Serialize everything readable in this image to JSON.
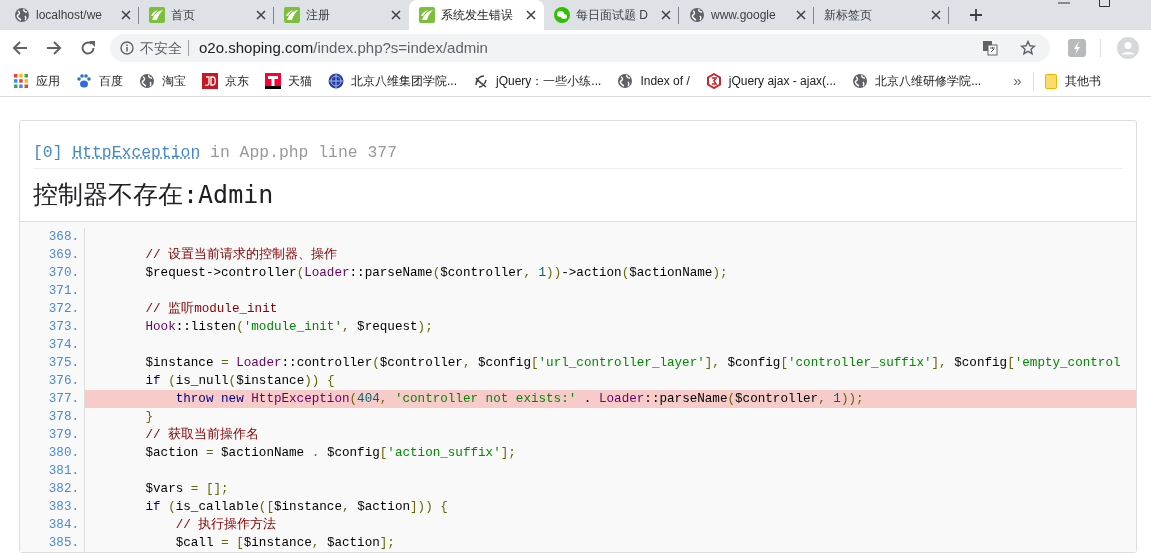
{
  "tabs": [
    {
      "title": "localhost/we",
      "kind": "globe",
      "selected": false
    },
    {
      "title": "首页",
      "kind": "leaf",
      "selected": false
    },
    {
      "title": "注册",
      "kind": "leaf",
      "selected": false
    },
    {
      "title": "系统发生错误",
      "kind": "leaf",
      "selected": true
    },
    {
      "title": "每日面试题 D",
      "kind": "chat",
      "selected": false
    },
    {
      "title": "www.google",
      "kind": "globe",
      "selected": false
    },
    {
      "title": "新标签页",
      "kind": "blank",
      "selected": false
    }
  ],
  "address": {
    "security": "不安全",
    "host": "o2o.shoping.com",
    "path": "/index.php?s=index/admin"
  },
  "bookmarks": [
    {
      "label": "应用",
      "kind": "apps"
    },
    {
      "label": "百度",
      "kind": "paw"
    },
    {
      "label": "淘宝",
      "kind": "globe"
    },
    {
      "label": "京东",
      "kind": "red"
    },
    {
      "label": "天猫",
      "kind": "tee"
    },
    {
      "label": "北京八维集团学院...",
      "kind": "orb"
    },
    {
      "label": "jQuery：一些小练...",
      "kind": "curl"
    },
    {
      "label": "Index of /",
      "kind": "globe"
    },
    {
      "label": "jQuery ajax - ajax(...",
      "kind": "hex"
    },
    {
      "label": "北京八维研修学院...",
      "kind": "globe"
    }
  ],
  "bookmarks_overflow": "»",
  "other_bookmarks": "其他书",
  "error": {
    "index": "[0]",
    "exception": "HttpException",
    "location": "in App.php line 377",
    "message": "控制器不存在:Admin"
  },
  "code": [
    {
      "number": "368.",
      "highlighted": false
    },
    {
      "number": "369.",
      "highlighted": false,
      "tokens": [
        {
          "kind": "com",
          "text": "        // 设置当前请求的控制器、操作"
        }
      ]
    },
    {
      "number": "370.",
      "highlighted": false,
      "tokens": [
        {
          "kind": "pln",
          "text": "        $request->controller"
        },
        {
          "kind": "pun",
          "text": "("
        },
        {
          "kind": "typ",
          "text": "Loader"
        },
        {
          "kind": "pln",
          "text": "::parseName"
        },
        {
          "kind": "pun",
          "text": "("
        },
        {
          "kind": "pln",
          "text": "$controller"
        },
        {
          "kind": "pun",
          "text": ", "
        },
        {
          "kind": "lit",
          "text": "1"
        },
        {
          "kind": "pun",
          "text": "))"
        },
        {
          "kind": "pln",
          "text": "->action"
        },
        {
          "kind": "pun",
          "text": "("
        },
        {
          "kind": "pln",
          "text": "$actionName"
        },
        {
          "kind": "pun",
          "text": ");"
        }
      ]
    },
    {
      "number": "371.",
      "highlighted": false
    },
    {
      "number": "372.",
      "highlighted": false,
      "tokens": [
        {
          "kind": "com",
          "text": "        // 监听module_init"
        }
      ]
    },
    {
      "number": "373.",
      "highlighted": false,
      "tokens": [
        {
          "kind": "typ",
          "text": "        Hook"
        },
        {
          "kind": "pln",
          "text": "::listen"
        },
        {
          "kind": "pun",
          "text": "("
        },
        {
          "kind": "str",
          "text": "'module_init'"
        },
        {
          "kind": "pun",
          "text": ", "
        },
        {
          "kind": "pln",
          "text": "$request"
        },
        {
          "kind": "pun",
          "text": ");"
        }
      ]
    },
    {
      "number": "374.",
      "highlighted": false
    },
    {
      "number": "375.",
      "highlighted": false,
      "tokens": [
        {
          "kind": "pln",
          "text": "        $instance "
        },
        {
          "kind": "pun",
          "text": "= "
        },
        {
          "kind": "typ",
          "text": "Loader"
        },
        {
          "kind": "pln",
          "text": "::controller"
        },
        {
          "kind": "pun",
          "text": "("
        },
        {
          "kind": "pln",
          "text": "$controller"
        },
        {
          "kind": "pun",
          "text": ", "
        },
        {
          "kind": "pln",
          "text": "$config"
        },
        {
          "kind": "pun",
          "text": "["
        },
        {
          "kind": "str",
          "text": "'url_controller_layer'"
        },
        {
          "kind": "pun",
          "text": "], "
        },
        {
          "kind": "pln",
          "text": "$config"
        },
        {
          "kind": "pun",
          "text": "["
        },
        {
          "kind": "str",
          "text": "'controller_suffix'"
        },
        {
          "kind": "pun",
          "text": "], "
        },
        {
          "kind": "pln",
          "text": "$config"
        },
        {
          "kind": "pun",
          "text": "["
        },
        {
          "kind": "str",
          "text": "'empty_control"
        }
      ]
    },
    {
      "number": "376.",
      "highlighted": false,
      "tokens": [
        {
          "kind": "kwd",
          "text": "        if"
        },
        {
          "kind": "pun",
          "text": " ("
        },
        {
          "kind": "pln",
          "text": "is_null"
        },
        {
          "kind": "pun",
          "text": "("
        },
        {
          "kind": "pln",
          "text": "$instance"
        },
        {
          "kind": "pun",
          "text": ")) {"
        }
      ]
    },
    {
      "number": "377.",
      "highlighted": true,
      "tokens": [
        {
          "kind": "kwd",
          "text": "            throw new"
        },
        {
          "kind": "typ",
          "text": " HttpException"
        },
        {
          "kind": "pun",
          "text": "("
        },
        {
          "kind": "lit",
          "text": "404"
        },
        {
          "kind": "pun",
          "text": ", "
        },
        {
          "kind": "str",
          "text": "'controller not exists:'"
        },
        {
          "kind": "pln",
          "text": " . "
        },
        {
          "kind": "typ",
          "text": "Loader"
        },
        {
          "kind": "pln",
          "text": "::parseName"
        },
        {
          "kind": "pun",
          "text": "("
        },
        {
          "kind": "pln",
          "text": "$controller"
        },
        {
          "kind": "pun",
          "text": ", "
        },
        {
          "kind": "lit",
          "text": "1"
        },
        {
          "kind": "pun",
          "text": "));"
        }
      ]
    },
    {
      "number": "378.",
      "highlighted": false,
      "tokens": [
        {
          "kind": "pun",
          "text": "        }"
        }
      ]
    },
    {
      "number": "379.",
      "highlighted": false,
      "tokens": [
        {
          "kind": "com",
          "text": "        // 获取当前操作名"
        }
      ]
    },
    {
      "number": "380.",
      "highlighted": false,
      "tokens": [
        {
          "kind": "pln",
          "text": "        $action "
        },
        {
          "kind": "pun",
          "text": "= "
        },
        {
          "kind": "pln",
          "text": "$actionName "
        },
        {
          "kind": "pun",
          "text": ". "
        },
        {
          "kind": "pln",
          "text": "$config"
        },
        {
          "kind": "pun",
          "text": "["
        },
        {
          "kind": "str",
          "text": "'action_suffix'"
        },
        {
          "kind": "pun",
          "text": "];"
        }
      ]
    },
    {
      "number": "381.",
      "highlighted": false
    },
    {
      "number": "382.",
      "highlighted": false,
      "tokens": [
        {
          "kind": "pln",
          "text": "        $vars "
        },
        {
          "kind": "pun",
          "text": "= [];"
        }
      ]
    },
    {
      "number": "383.",
      "highlighted": false,
      "tokens": [
        {
          "kind": "kwd",
          "text": "        if"
        },
        {
          "kind": "pun",
          "text": " ("
        },
        {
          "kind": "pln",
          "text": "is_callable"
        },
        {
          "kind": "pun",
          "text": "(["
        },
        {
          "kind": "pln",
          "text": "$instance"
        },
        {
          "kind": "pun",
          "text": ", "
        },
        {
          "kind": "pln",
          "text": "$action"
        },
        {
          "kind": "pun",
          "text": "])) {"
        }
      ]
    },
    {
      "number": "384.",
      "highlighted": false,
      "tokens": [
        {
          "kind": "com",
          "text": "            // 执行操作方法"
        }
      ]
    },
    {
      "number": "385.",
      "highlighted": false,
      "tokens": [
        {
          "kind": "pln",
          "text": "            $call "
        },
        {
          "kind": "pun",
          "text": "= ["
        },
        {
          "kind": "pln",
          "text": "$instance"
        },
        {
          "kind": "pun",
          "text": ", "
        },
        {
          "kind": "pln",
          "text": "$action"
        },
        {
          "kind": "pun",
          "text": "];"
        }
      ]
    }
  ]
}
